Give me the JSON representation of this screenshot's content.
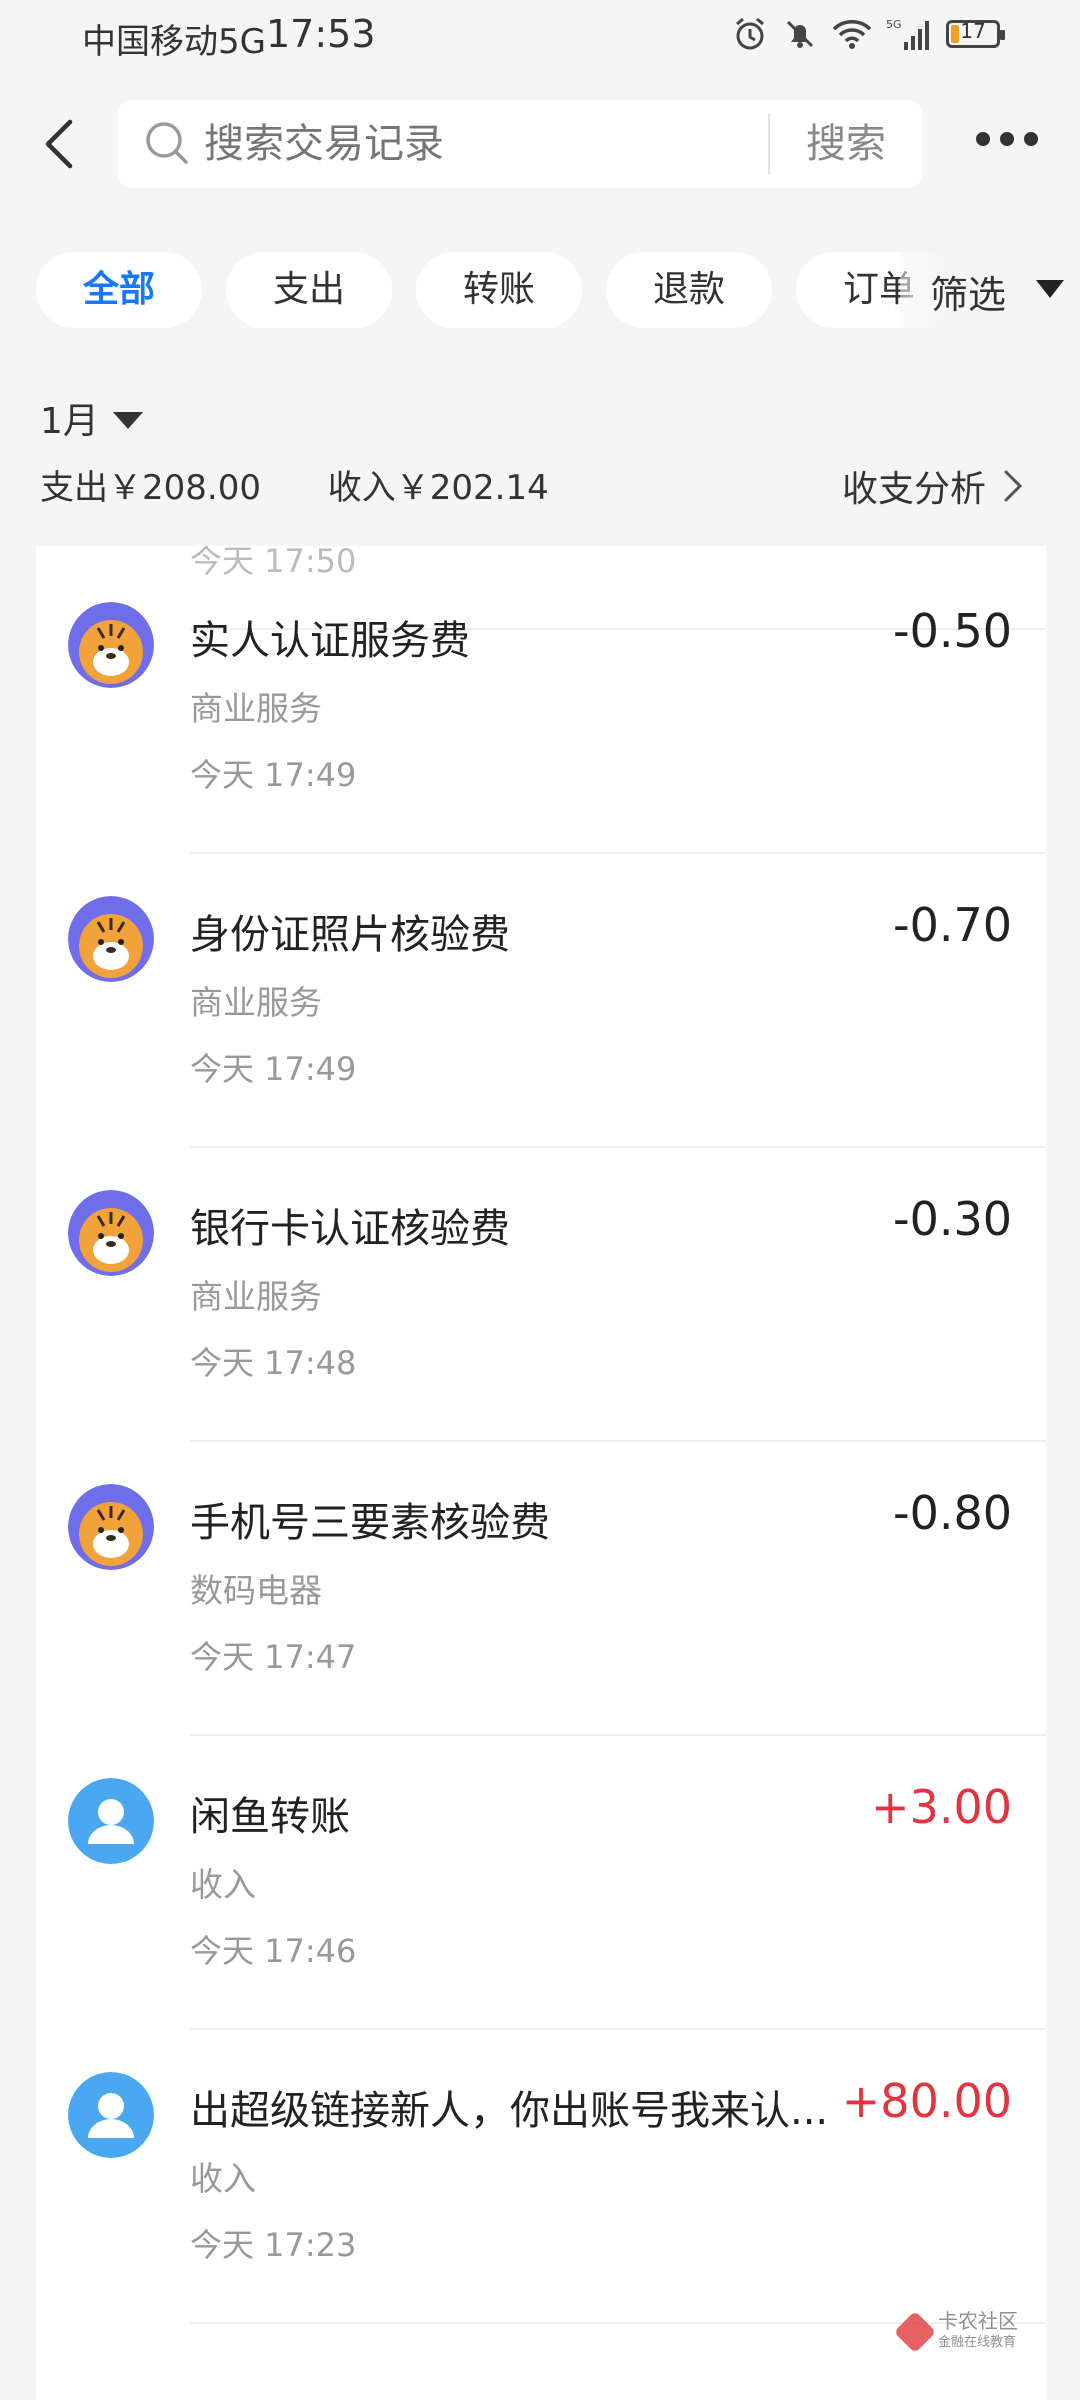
{
  "status_bar": {
    "carrier": "中国移动5G",
    "time": "17:53",
    "battery": "17",
    "icons": [
      "alarm-icon",
      "mute-bell-icon",
      "wifi-icon",
      "signal-5g-icon",
      "battery-icon"
    ]
  },
  "header": {
    "search_placeholder": "搜索交易记录",
    "search_button": "搜索"
  },
  "chips": [
    "全部",
    "支出",
    "转账",
    "退款",
    "订单"
  ],
  "filter_label": "筛选",
  "month": "1月",
  "summary": {
    "expense": "支出￥208.00",
    "income": "收入￥202.14",
    "analysis": "收支分析"
  },
  "partial_row_time": "今天 17:50",
  "transactions": [
    {
      "title": "实人认证服务费",
      "category": "商业服务",
      "time": "今天 17:49",
      "amount": "-0.50",
      "avatar": "tiger-avatar"
    },
    {
      "title": "身份证照片核验费",
      "category": "商业服务",
      "time": "今天 17:49",
      "amount": "-0.70",
      "avatar": "tiger-avatar"
    },
    {
      "title": "银行卡认证核验费",
      "category": "商业服务",
      "time": "今天 17:48",
      "amount": "-0.30",
      "avatar": "tiger-avatar"
    },
    {
      "title": "手机号三要素核验费",
      "category": "数码电器",
      "time": "今天 17:47",
      "amount": "-0.80",
      "avatar": "tiger-avatar"
    },
    {
      "title": "闲鱼转账",
      "category": "收入",
      "time": "今天 17:46",
      "amount": "+3.00",
      "avatar": "user-avatar"
    },
    {
      "title": "出超级链接新人，你出账号我来认...",
      "category": "收入",
      "time": "今天 17:23",
      "amount": "+80.00",
      "avatar": "user-avatar"
    }
  ],
  "colors": {
    "accent": "#1677ff",
    "income": "#e0353f",
    "background": "#f5f5f5"
  },
  "watermark": {
    "name": "卡农社区",
    "tagline": "金融在线教育"
  }
}
